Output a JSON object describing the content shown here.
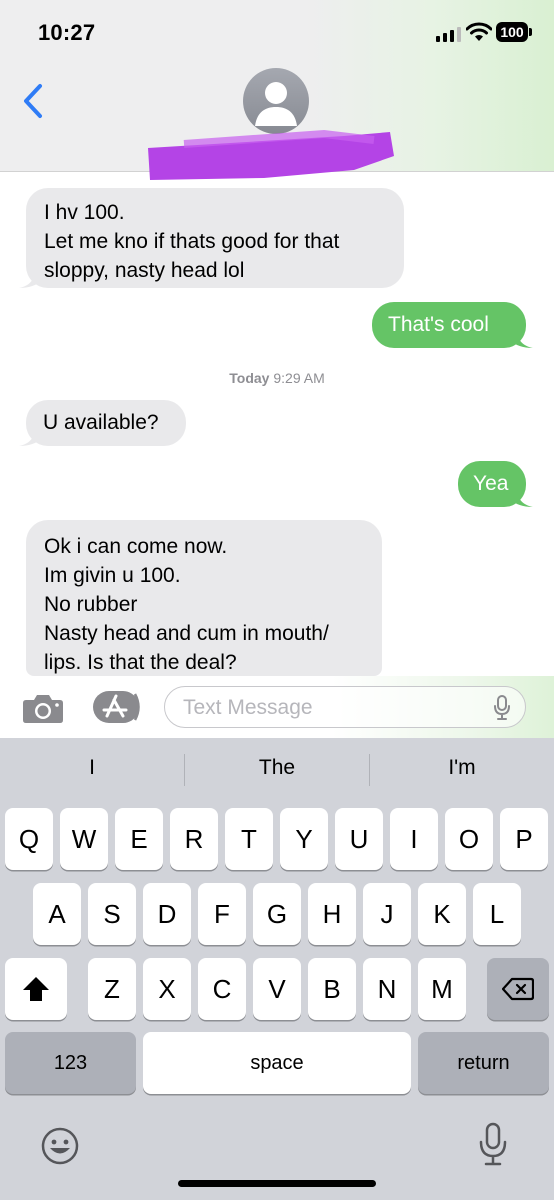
{
  "status": {
    "time": "10:27",
    "battery": "100"
  },
  "header": {
    "contact": "redacted"
  },
  "messages": [
    {
      "dir": "in",
      "lines": [
        "I hv 100.",
        "Let me kno if thats good for that",
        "sloppy, nasty head lol"
      ]
    },
    {
      "dir": "out",
      "text": "That's cool"
    },
    {
      "dir": "in",
      "text": "U available?"
    },
    {
      "dir": "out",
      "text": "Yea"
    },
    {
      "dir": "in",
      "lines": [
        "Ok i can come now.",
        "Im givin u 100.",
        "No rubber",
        "Nasty head and cum in mouth/",
        "lips. Is that the deal?"
      ]
    }
  ],
  "timestamp": {
    "day": "Today",
    "time": "9:29 AM"
  },
  "composer": {
    "placeholder": "Text Message"
  },
  "keyboard": {
    "suggestions": [
      "I",
      "The",
      "I'm"
    ],
    "row1": [
      "Q",
      "W",
      "E",
      "R",
      "T",
      "Y",
      "U",
      "I",
      "O",
      "P"
    ],
    "row2": [
      "A",
      "S",
      "D",
      "F",
      "G",
      "H",
      "J",
      "K",
      "L"
    ],
    "row3": [
      "Z",
      "X",
      "C",
      "V",
      "B",
      "N",
      "M"
    ],
    "numbers_label": "123",
    "space_label": "space",
    "return_label": "return"
  },
  "colors": {
    "outgoing": "#65c466",
    "incoming": "#e9e9eb",
    "accent": "#2f7cf6"
  },
  "icons": [
    "back-chevron-icon",
    "contact-avatar-icon",
    "camera-icon",
    "app-store-icon",
    "microphone-icon",
    "shift-icon",
    "delete-icon",
    "emoji-icon",
    "dictation-icon",
    "wifi-icon",
    "cellular-signal-icon",
    "battery-icon"
  ]
}
